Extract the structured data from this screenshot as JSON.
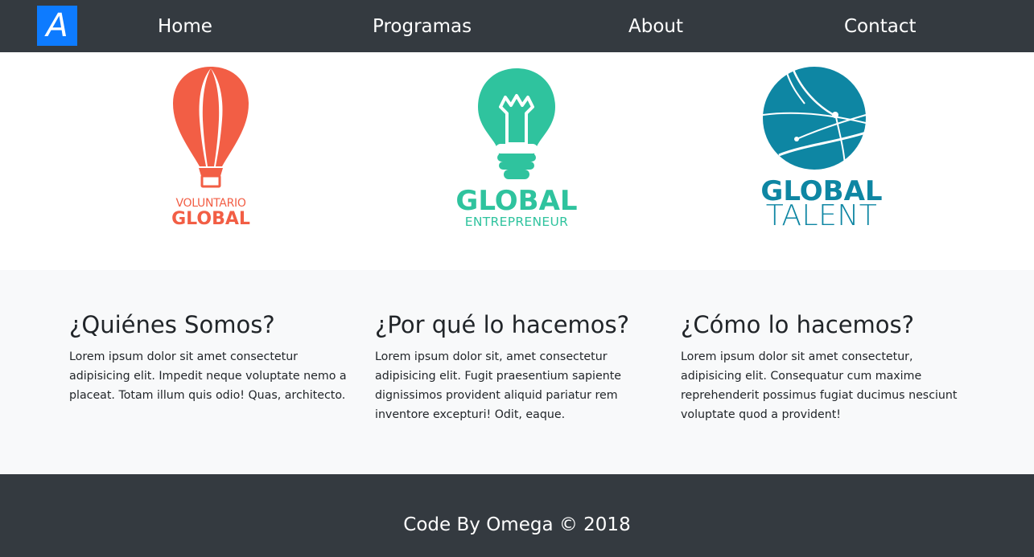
{
  "navbar": {
    "brand_letter": "A",
    "links": [
      "Home",
      "Programas",
      "About",
      "Contact"
    ]
  },
  "logos": [
    {
      "icon": "hot-air-balloon-icon",
      "line1": "VOLUNTARIO",
      "line2": "GLOBAL",
      "color": "#f25e45"
    },
    {
      "icon": "light-bulb-icon",
      "line1": "GLOBAL",
      "line2": "ENTREPRENEUR",
      "color": "#2fc39e"
    },
    {
      "icon": "globe-icon",
      "line1": "GLOBAL",
      "line2": "TALENT",
      "color": "#0e86a3"
    }
  ],
  "about": [
    {
      "title": "¿Quiénes Somos?",
      "text": "Lorem ipsum dolor sit amet consectetur adipisicing elit. Impedit neque voluptate nemo a placeat. Totam illum quis odio! Quas, architecto."
    },
    {
      "title": "¿Por qué lo hacemos?",
      "text": "Lorem ipsum dolor sit, amet consectetur adipisicing elit. Fugit praesentium sapiente dignissimos provident aliquid pariatur rem inventore excepturi! Odit, eaque."
    },
    {
      "title": "¿Cómo lo hacemos?",
      "text": "Lorem ipsum dolor sit amet consectetur, adipisicing elit. Consequatur cum maxime reprehenderit possimus fugiat ducimus nesciunt voluptate quod a provident!"
    }
  ],
  "footer": {
    "text": "Code By Omega © 2018"
  },
  "colors": {
    "navbar_bg": "#343a40",
    "brand_bg": "#0d7bff",
    "section_bg": "#f8f9fa"
  }
}
